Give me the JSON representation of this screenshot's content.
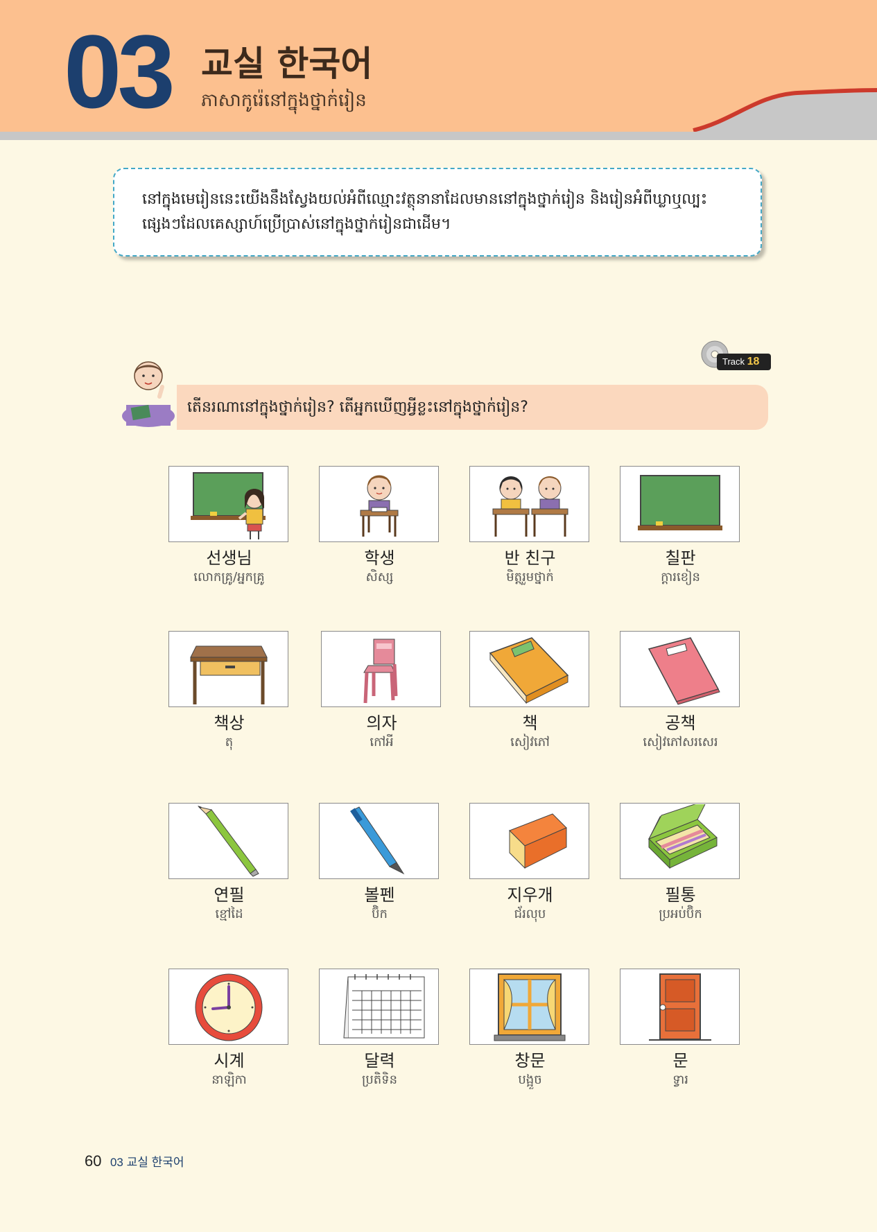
{
  "header": {
    "chapter_number": "03",
    "title": "교실 한국어",
    "subtitle": "ភាសាកូរ៉េនៅក្នុងថ្នាក់រៀន"
  },
  "intro": {
    "text": "នៅក្នុងមេរៀននេះយើងនឹងស្វែងយល់អំពីឈ្មោះវត្ថុនានាដែលមាននៅក្នុងថ្នាក់រៀន និងរៀនអំពីឃ្លាឬល្បះផ្សេងៗដែលគេស្សាហ៍ប្រើប្រាស់នៅក្នុងថ្នាក់រៀនជាដើម។"
  },
  "track": {
    "label": "Track",
    "number": "18"
  },
  "question": {
    "text": "តើនរណានៅក្នុងថ្នាក់រៀន? តើអ្នកឃើញអ្វីខ្លះនៅក្នុងថ្នាក់រៀន?"
  },
  "vocab": [
    {
      "ko": "선생님",
      "km": "លោកគ្រូ/អ្នកគ្រូ",
      "icon": "teacher-board-icon"
    },
    {
      "ko": "학생",
      "km": "សិស្ស",
      "icon": "student-icon"
    },
    {
      "ko": "반 친구",
      "km": "មិត្តរួមថ្នាក់",
      "icon": "classmates-icon"
    },
    {
      "ko": "칠판",
      "km": "ក្ដារខៀន",
      "icon": "blackboard-icon"
    },
    {
      "ko": "책상",
      "km": "តុ",
      "icon": "desk-icon"
    },
    {
      "ko": "의자",
      "km": "កៅអី",
      "icon": "chair-icon"
    },
    {
      "ko": "책",
      "km": "សៀវភៅ",
      "icon": "book-icon"
    },
    {
      "ko": "공책",
      "km": "សៀវភៅសរសេរ",
      "icon": "notebook-icon"
    },
    {
      "ko": "연필",
      "km": "ខ្មៅដៃ",
      "icon": "pencil-icon"
    },
    {
      "ko": "볼펜",
      "km": "ប៊ិក",
      "icon": "ballpen-icon"
    },
    {
      "ko": "지우개",
      "km": "ជ័រលុប",
      "icon": "eraser-icon"
    },
    {
      "ko": "필통",
      "km": "ប្រអប់ប៊ិក",
      "icon": "pencil-case-icon"
    },
    {
      "ko": "시계",
      "km": "នាឡិកា",
      "icon": "clock-icon"
    },
    {
      "ko": "달력",
      "km": "ប្រតិទិន",
      "icon": "calendar-icon"
    },
    {
      "ko": "창문",
      "km": "បង្អួច",
      "icon": "window-icon"
    },
    {
      "ko": "문",
      "km": "ទ្វារ",
      "icon": "door-icon"
    }
  ],
  "footer": {
    "page_number": "60",
    "chapter": "03 교실 한국어"
  },
  "colors": {
    "header_bg": "#fcc08f",
    "chapter_num": "#1c3f6e",
    "accent_red": "#cc3a2c",
    "page_bg": "#fdf8e4",
    "dashed_border": "#43a8c6"
  }
}
